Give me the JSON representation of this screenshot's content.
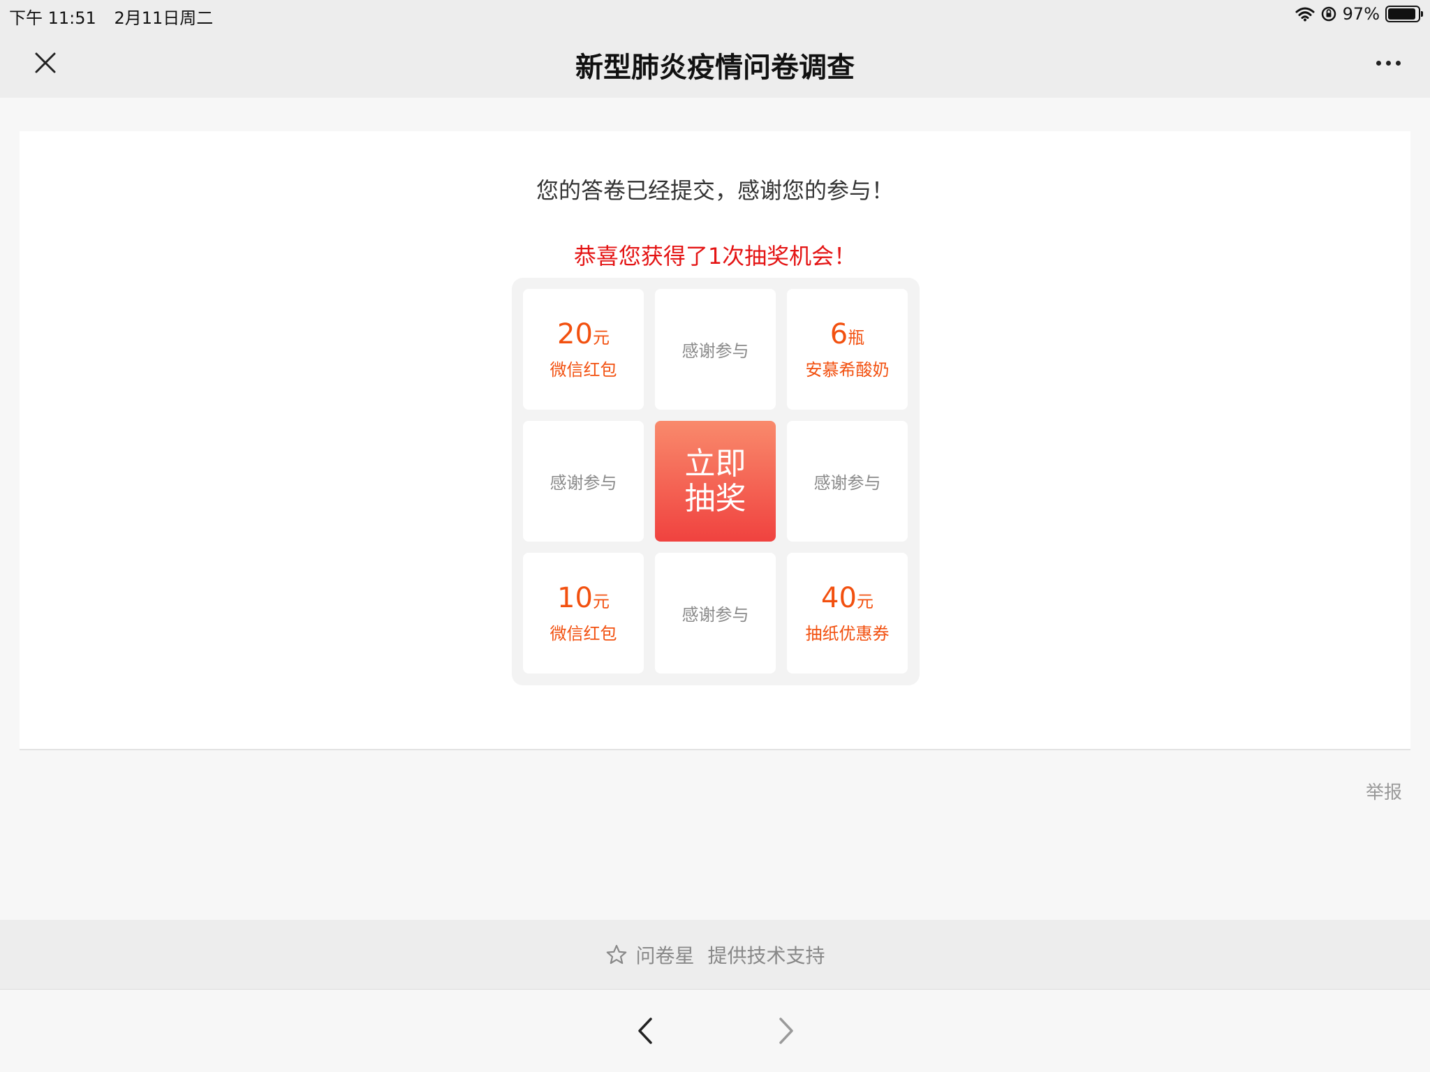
{
  "status_bar": {
    "time": "下午 11:51",
    "date": "2月11日周二",
    "battery_percent": "97%",
    "battery_level": 0.97
  },
  "nav": {
    "title": "新型肺炎疫情问卷调查",
    "close_icon": "close-icon",
    "more_icon": "more-dots-icon"
  },
  "main": {
    "submitted_message": "您的答卷已经提交，感谢您的参与！",
    "congrats_message": "恭喜您获得了1次抽奖机会！",
    "draw_button_line1": "立即",
    "draw_button_line2": "抽奖",
    "report_link": "举报"
  },
  "lottery": [
    {
      "amount": "20",
      "unit": "元",
      "name": "微信红包"
    },
    {
      "thanks": "感谢参与"
    },
    {
      "amount": "6",
      "unit": "瓶",
      "name": "安慕希酸奶"
    },
    {
      "thanks": "感谢参与"
    },
    {
      "thanks": "感谢参与"
    },
    {
      "amount": "10",
      "unit": "元",
      "name": "微信红包"
    },
    {
      "thanks": "感谢参与"
    },
    {
      "amount": "40",
      "unit": "元",
      "name": "抽纸优惠券"
    }
  ],
  "footer": {
    "brand": "问卷星",
    "support": "提供技术支持",
    "icon": "star-icon"
  },
  "toolbar": {
    "back_icon": "chevron-left-icon",
    "forward_icon": "chevron-right-icon"
  },
  "colors": {
    "prize": "#f2500f",
    "congrats": "#e41414",
    "draw_button_top": "#f98a6c",
    "draw_button_bottom": "#f0423f"
  }
}
